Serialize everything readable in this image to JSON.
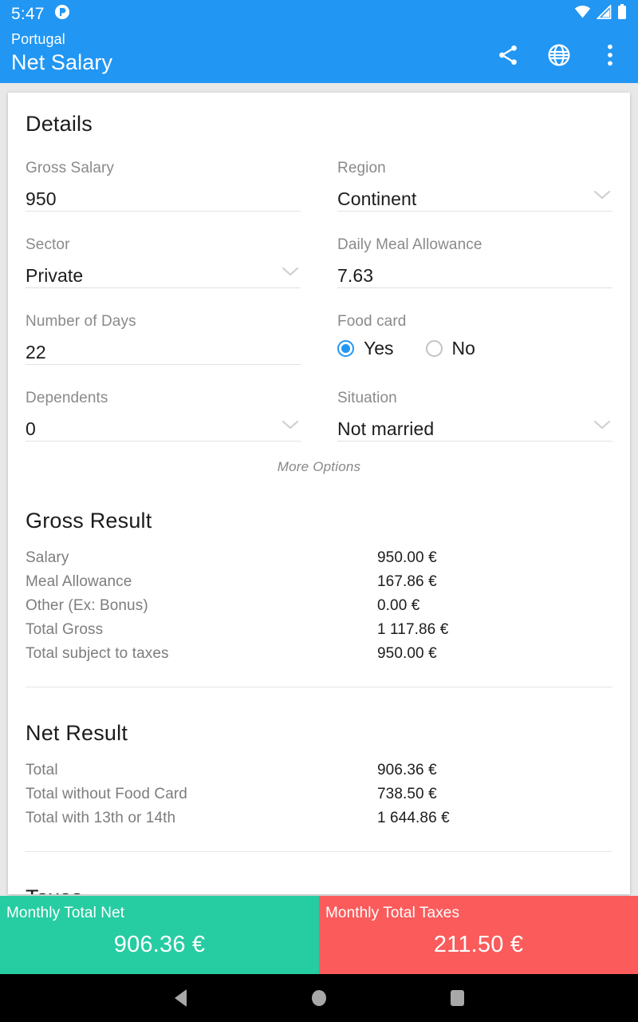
{
  "statusbar": {
    "time": "5:47",
    "icons": [
      "app-indicator-icon",
      "wifi-icon",
      "signal-icon",
      "battery-icon"
    ]
  },
  "toolbar": {
    "subtitle": "Portugal",
    "title": "Net Salary",
    "actions": [
      {
        "name": "share-icon",
        "label": "Share"
      },
      {
        "name": "globe-icon",
        "label": "Language"
      },
      {
        "name": "overflow-menu-icon",
        "label": "More"
      }
    ]
  },
  "details": {
    "heading": "Details",
    "left_fields": [
      {
        "label": "Gross Salary",
        "value": "950",
        "type": "text"
      },
      {
        "label": "Sector",
        "value": "Private",
        "type": "select"
      },
      {
        "label": "Number of Days",
        "value": "22",
        "type": "text"
      },
      {
        "label": "Dependents",
        "value": "0",
        "type": "select"
      }
    ],
    "right_fields": [
      {
        "label": "Region",
        "value": "Continent",
        "type": "select"
      },
      {
        "label": "Daily Meal Allowance",
        "value": "7.63",
        "type": "text"
      },
      {
        "label": "Food card",
        "type": "radio",
        "options": [
          "Yes",
          "No"
        ],
        "selected": "Yes"
      },
      {
        "label": "Situation",
        "value": "Not married",
        "type": "select"
      }
    ],
    "more_options": "More Options"
  },
  "gross_result": {
    "heading": "Gross Result",
    "rows": [
      {
        "label": "Salary",
        "value": "950.00 €"
      },
      {
        "label": "Meal Allowance",
        "value": "167.86 €"
      },
      {
        "label": "Other (Ex: Bonus)",
        "value": "0.00 €"
      },
      {
        "label": "Total Gross",
        "value": "1 117.86 €"
      },
      {
        "label": "Total subject to taxes",
        "value": "950.00 €"
      }
    ]
  },
  "net_result": {
    "heading": "Net Result",
    "rows": [
      {
        "label": "Total",
        "value": "906.36 €"
      },
      {
        "label": "Total without Food Card",
        "value": "738.50 €"
      },
      {
        "label": "Total with 13th or 14th",
        "value": "1 644.86 €"
      }
    ]
  },
  "taxes": {
    "heading": "Taxes"
  },
  "summary": {
    "net": {
      "label": "Monthly Total Net",
      "value": "906.36 €",
      "color": "#26cca2"
    },
    "taxes": {
      "label": "Monthly Total Taxes",
      "value": "211.50 €",
      "color": "#fb5b5b"
    }
  },
  "navbar": {
    "back": "back-button",
    "home": "home-button",
    "recents": "recents-button"
  },
  "theme": {
    "primary": "#2196f3",
    "accent_green": "#26cca2",
    "accent_red": "#fb5b5b"
  }
}
